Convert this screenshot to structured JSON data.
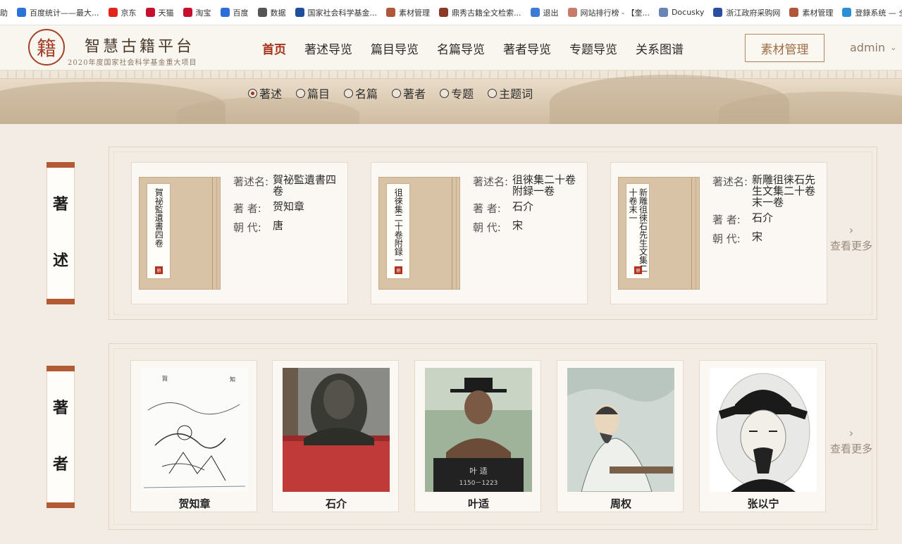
{
  "bookmarks": [
    {
      "label": "助",
      "icon": "bookmark-icon",
      "color": "#4a90d9"
    },
    {
      "label": "百度统计——最大...",
      "icon": "baidu-tongji-icon",
      "color": "#2b73d9"
    },
    {
      "label": "京东",
      "icon": "jd-icon",
      "color": "#e1251b"
    },
    {
      "label": "天猫",
      "icon": "tmall-icon",
      "color": "#c8102e"
    },
    {
      "label": "淘宝",
      "icon": "taobao-icon",
      "color": "#c8102e"
    },
    {
      "label": "百度",
      "icon": "baidu-icon",
      "color": "#2a6edb"
    },
    {
      "label": "数据",
      "icon": "globe-icon",
      "color": "#555555"
    },
    {
      "label": "国家社会科学基金...",
      "icon": "nssf-icon",
      "color": "#1f4e9c"
    },
    {
      "label": "素材管理",
      "icon": "sucai-icon",
      "color": "#b0573a"
    },
    {
      "label": "鼎秀古籍全文检索...",
      "icon": "book-icon",
      "color": "#8b3a2a"
    },
    {
      "label": "退出",
      "icon": "exit-icon",
      "color": "#3a7bd5"
    },
    {
      "label": "网站排行榜 - 【奎...",
      "icon": "rank-icon",
      "color": "#c77b6b"
    },
    {
      "label": "Docusky",
      "icon": "docusky-icon",
      "color": "#6a84b8"
    },
    {
      "label": "浙江政府采购网",
      "icon": "zhejiang-icon",
      "color": "#2a4fa0"
    },
    {
      "label": "素材管理",
      "icon": "sucai-icon",
      "color": "#b0573a"
    },
    {
      "label": "登錄系统 — 全部...",
      "icon": "login-icon",
      "color": "#2a8fd6"
    }
  ],
  "header": {
    "logo_char": "籍",
    "title": "智慧古籍平台",
    "subtitle": "2020年度国家社会科学基金重大项目",
    "nav": [
      {
        "label": "首页",
        "active": true
      },
      {
        "label": "著述导览"
      },
      {
        "label": "篇目导览"
      },
      {
        "label": "名篇导览"
      },
      {
        "label": "著者导览"
      },
      {
        "label": "专题导览"
      },
      {
        "label": "关系图谱"
      }
    ],
    "sucai_button": "素材管理",
    "user": "admin"
  },
  "search_types": [
    {
      "label": "著述",
      "checked": true
    },
    {
      "label": "篇目"
    },
    {
      "label": "名篇"
    },
    {
      "label": "著者"
    },
    {
      "label": "专题"
    },
    {
      "label": "主题词"
    }
  ],
  "works_section": {
    "title_chars": [
      "著",
      "述"
    ],
    "field_labels": {
      "title": "著述名:",
      "author": "著 者:",
      "dynasty": "朝 代:"
    },
    "items": [
      {
        "book_label": "賀祕監遺書四卷",
        "title": "賀祕監遺書四卷",
        "author": "贺知章",
        "dynasty": "唐"
      },
      {
        "book_label": "徂徠集二十卷附録一",
        "title": "徂徠集二十卷附録一卷",
        "author": "石介",
        "dynasty": "宋"
      },
      {
        "book_label": "新雕徂徠石先生文集二十卷末一",
        "title": "新雕徂徕石先生文集二十卷末一卷",
        "author": "石介",
        "dynasty": "宋"
      }
    ],
    "seal_char": "册",
    "more": "查看更多"
  },
  "authors_section": {
    "title_chars": [
      "著",
      "者"
    ],
    "items": [
      {
        "name": "贺知章",
        "portrait": "ink-sketch-portrait"
      },
      {
        "name": "石介",
        "portrait": "bronze-bust-portrait"
      },
      {
        "name": "叶适",
        "portrait": "statue-portrait",
        "plaque": "叶 适",
        "years": "1150－1223"
      },
      {
        "name": "周权",
        "portrait": "painting-portrait"
      },
      {
        "name": "张以宁",
        "portrait": "oval-ink-portrait"
      }
    ],
    "more": "查看更多"
  }
}
